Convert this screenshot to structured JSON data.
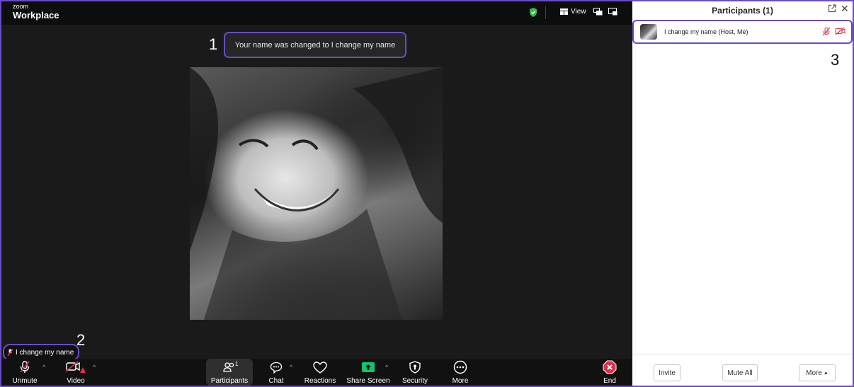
{
  "app": {
    "logo_small": "zoom",
    "logo_main": "Workplace"
  },
  "topbar": {
    "view_label": "View"
  },
  "notification": {
    "text": "Your name was changed to I change my name"
  },
  "markers": {
    "m1": "1",
    "m2": "2",
    "m3": "3"
  },
  "name_tag": {
    "text": "I change my name"
  },
  "controls": {
    "unmute": "Unmute",
    "video": "Video",
    "participants": "Participants",
    "participants_count": "1",
    "chat": "Chat",
    "reactions": "Reactions",
    "share_screen": "Share Screen",
    "security": "Security",
    "more": "More",
    "end": "End"
  },
  "panel": {
    "title": "Participants (1)",
    "participant_name": "I change my name (Host, Me)",
    "invite": "Invite",
    "mute_all": "Mute All",
    "more": "More"
  },
  "colors": {
    "accent": "#6a4bc4",
    "muted_red": "#e0314b",
    "share_green": "#0ec76b",
    "shield_green": "#2fbf4a"
  }
}
